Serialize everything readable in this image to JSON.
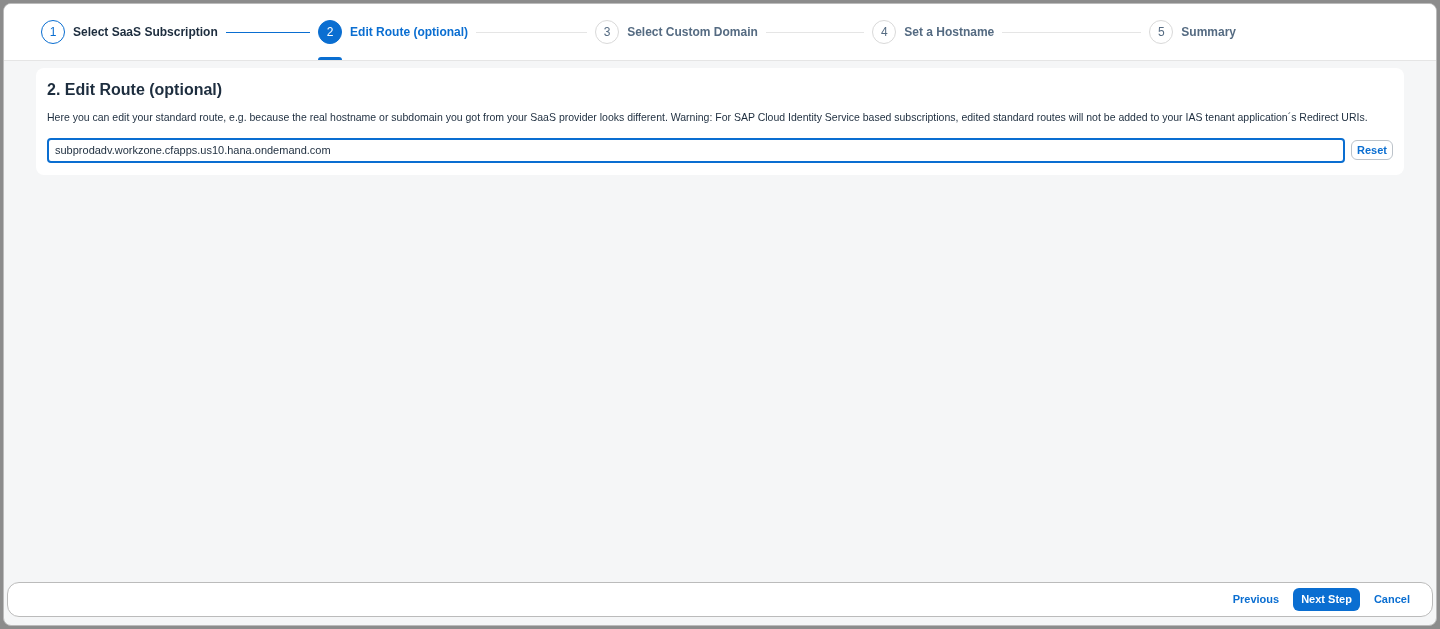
{
  "wizard": {
    "steps": [
      {
        "number": "1",
        "label": "Select SaaS Subscription",
        "completed": true,
        "selected": false
      },
      {
        "number": "2",
        "label": "Edit Route (optional)",
        "completed": false,
        "selected": true
      },
      {
        "number": "3",
        "label": "Select Custom Domain",
        "completed": false,
        "selected": false
      },
      {
        "number": "4",
        "label": "Set a Hostname",
        "completed": false,
        "selected": false
      },
      {
        "number": "5",
        "label": "Summary",
        "completed": false,
        "selected": false
      }
    ]
  },
  "section": {
    "title": "2. Edit Route (optional)",
    "description": "Here you can edit your standard route, e.g. because the real hostname or subdomain you got from your SaaS provider looks different. Warning: For SAP Cloud Identity Service based subscriptions, edited standard routes will not be added to your IAS tenant application´s Redirect URIs.",
    "route": {
      "value": "subprodadv.workzone.cfapps.us10.hana.ondemand.com"
    },
    "reset_button": "Reset"
  },
  "footer": {
    "buttons": [
      {
        "label": "Previous",
        "kind": "link"
      },
      {
        "label": "Next Step",
        "kind": "primary"
      },
      {
        "label": "Cancel",
        "kind": "link"
      }
    ]
  }
}
